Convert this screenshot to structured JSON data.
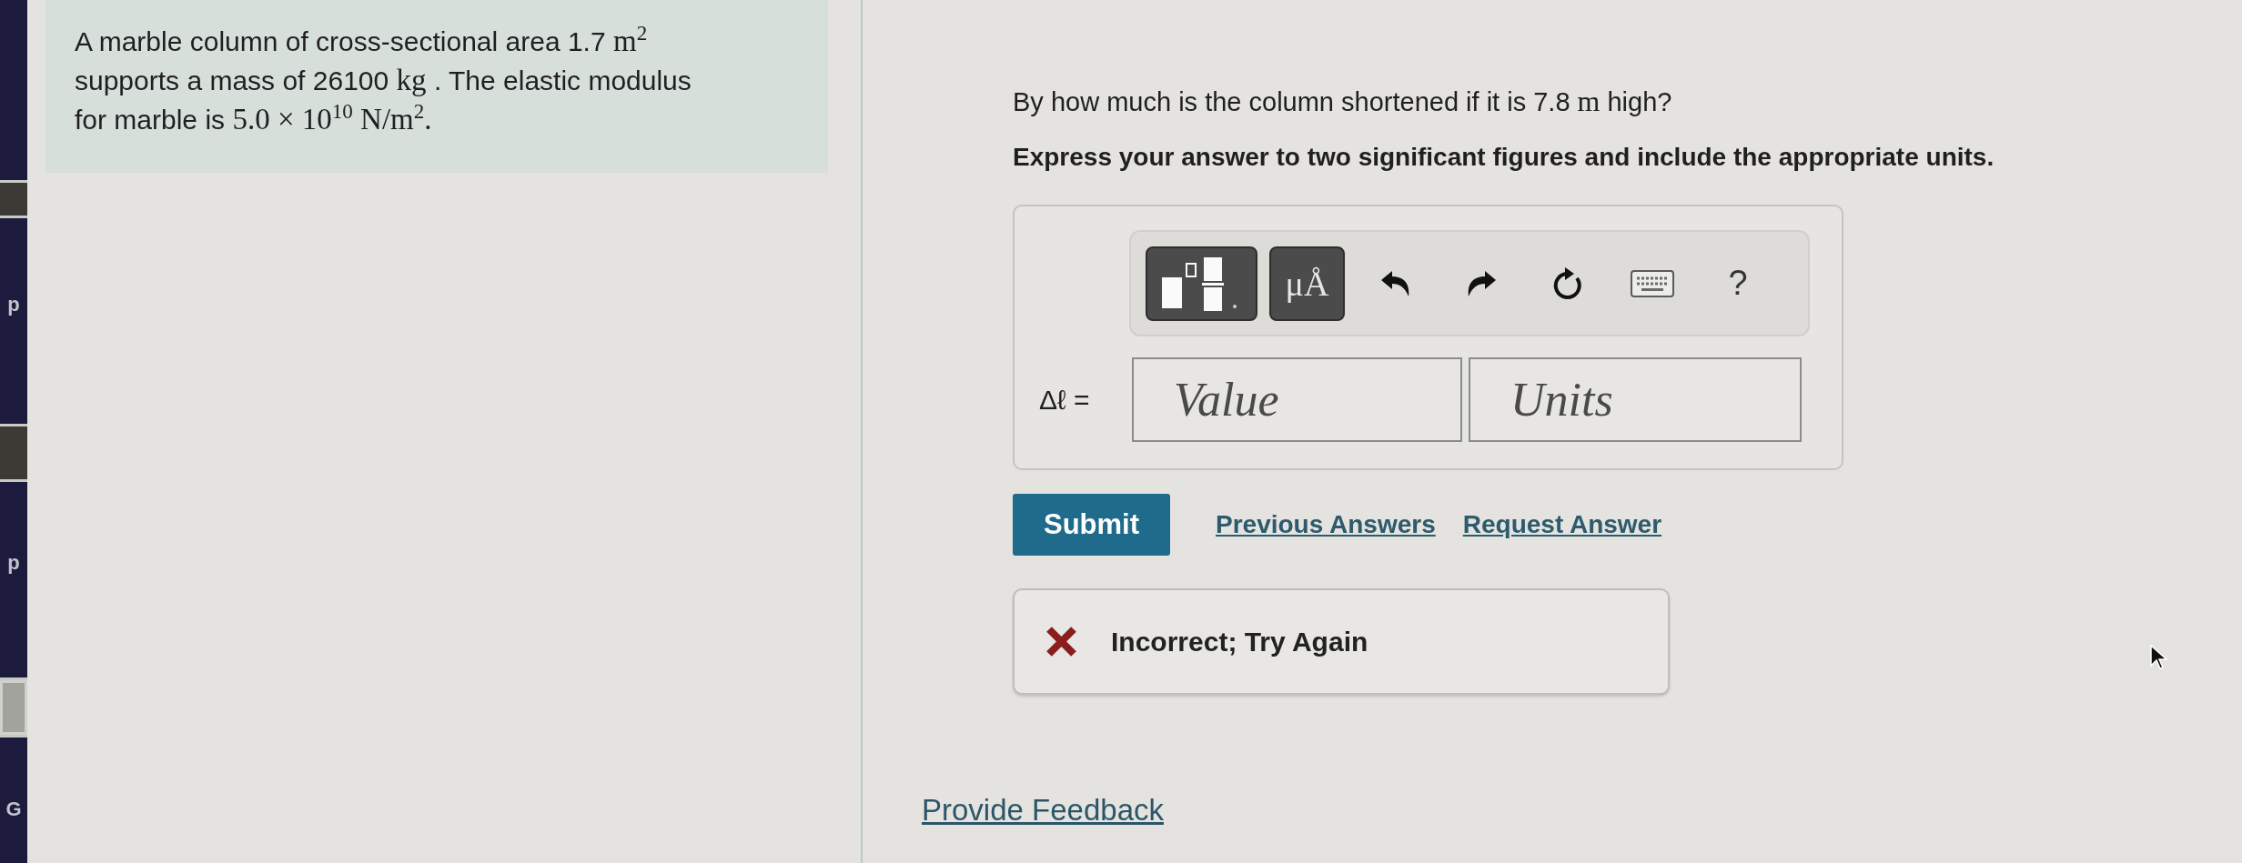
{
  "sidebar": {
    "items": [
      {
        "label": "p"
      },
      {
        "label": "p"
      },
      {
        "label": "G"
      }
    ]
  },
  "problem": {
    "lines": [
      [
        {
          "kind": "text",
          "text": "A marble column of cross-sectional area 1.7 "
        },
        {
          "kind": "math",
          "text": "m$^{2}$"
        }
      ],
      [
        {
          "kind": "text",
          "text": "supports a mass of 26100 "
        },
        {
          "kind": "math",
          "text": "kg"
        },
        {
          "kind": "text",
          "text": " . The elastic modulus"
        }
      ],
      [
        {
          "kind": "text",
          "text": "for marble is "
        },
        {
          "kind": "math",
          "text": "5.0 × 10$^{10}$ N/m$^{2}$."
        }
      ]
    ]
  },
  "question": {
    "segments": [
      {
        "kind": "text",
        "text": "By how much is the column shortened if it is 7.8 "
      },
      {
        "kind": "math",
        "text": "m"
      },
      {
        "kind": "text",
        "text": " high?"
      }
    ]
  },
  "instruction": "Express your answer to two significant figures and include the appropriate units.",
  "answer": {
    "toolbar": {
      "units_label": "μÅ",
      "help_label": "?"
    },
    "variable": "Δℓ =",
    "fields": [
      {
        "placeholder": "Value"
      },
      {
        "placeholder": "Units"
      }
    ]
  },
  "actions": {
    "submit": "Submit",
    "links": [
      "Previous Answers",
      "Request Answer"
    ]
  },
  "feedback": {
    "correct": false,
    "text": "Incorrect; Try Again"
  },
  "footer_link": "Provide Feedback"
}
